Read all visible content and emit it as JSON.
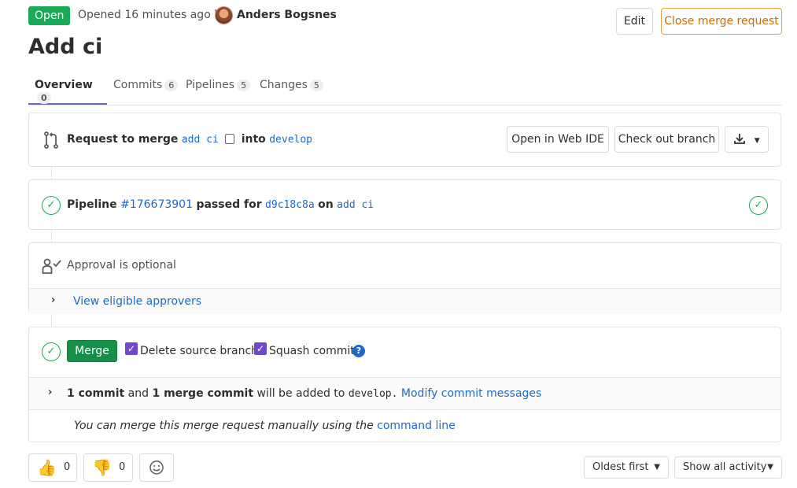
{
  "header": {
    "status": "Open",
    "opened_text": "Opened 16 minutes ago by",
    "author": "Anders Bogsnes",
    "edit_label": "Edit",
    "close_label": "Close merge request"
  },
  "title": "Add ci",
  "tabs": [
    {
      "label": "Overview",
      "count": "0"
    },
    {
      "label": "Commits",
      "count": "6"
    },
    {
      "label": "Pipelines",
      "count": "5"
    },
    {
      "label": "Changes",
      "count": "5"
    }
  ],
  "request": {
    "prefix": "Request to merge",
    "source": "add ci",
    "into": "into",
    "target": "develop",
    "web_ide": "Open in Web IDE",
    "checkout": "Check out branch"
  },
  "pipeline": {
    "label": "Pipeline",
    "id": "#176673901",
    "passed_for": "passed for",
    "sha": "d9c18c8a",
    "on": "on",
    "branch": "add ci"
  },
  "approval": {
    "text": "Approval is optional",
    "link": "View eligible approvers"
  },
  "merge": {
    "button": "Merge",
    "delete_branch": "Delete source branch",
    "squash": "Squash commits",
    "commit_count": "1 commit",
    "and": "and",
    "merge_commit": "1 merge commit",
    "will_be_added": "will be added to",
    "target": "develop.",
    "modify": "Modify commit messages",
    "manual_text": "You can merge this merge request manually using the",
    "command_line": "command line"
  },
  "awards": {
    "thumbsup": "0",
    "thumbsdown": "0"
  },
  "sort": {
    "order": "Oldest first",
    "filter": "Show all activity"
  },
  "colors": {
    "open_badge": "#1aaa55",
    "close_button": "#c5700e",
    "merge_button": "#168f48",
    "link": "#1f69c9",
    "checkbox": "#6e49cb",
    "active_tab": "#6666c4"
  }
}
